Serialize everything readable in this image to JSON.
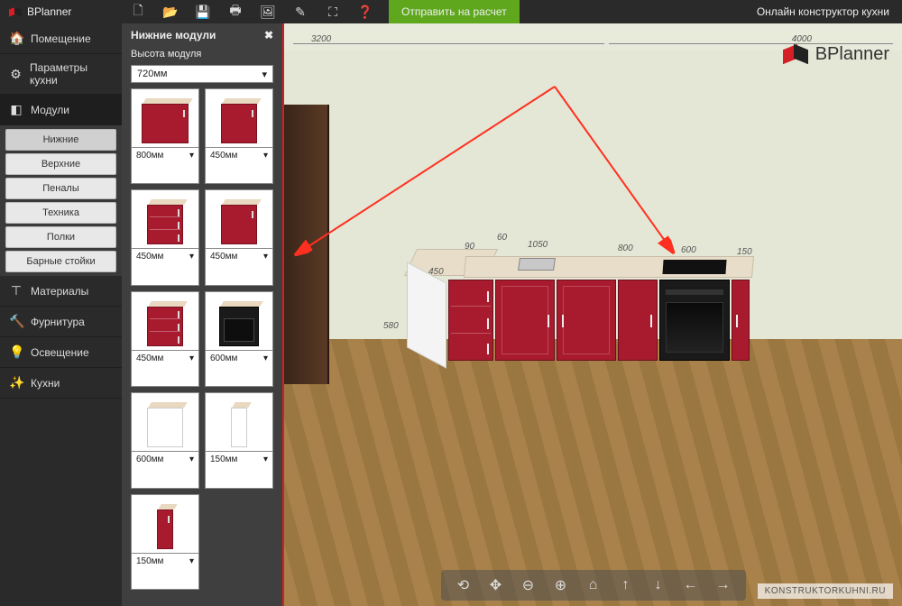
{
  "app": {
    "name": "BPlanner",
    "title": "Онлайн конструктор кухни"
  },
  "topbar": {
    "send_label": "Отправить на расчет",
    "icons": [
      "new-file",
      "open-file",
      "save",
      "print",
      "image",
      "edit",
      "fullscreen",
      "help"
    ]
  },
  "sidebar": {
    "room": "Помещение",
    "params": "Параметры кухни",
    "modules": "Модули",
    "materials": "Материалы",
    "hardware": "Фурнитура",
    "lighting": "Освещение",
    "kitchens": "Кухни",
    "sub": {
      "lower": "Нижние",
      "upper": "Верхние",
      "tall": "Пеналы",
      "appliances": "Техника",
      "shelves": "Полки",
      "bar": "Барные стойки"
    }
  },
  "palette": {
    "title": "Нижние модули",
    "height_label": "Высота модуля",
    "height_value": "720мм",
    "cards": [
      {
        "w": "800мм",
        "kind": "red"
      },
      {
        "w": "450мм",
        "kind": "red"
      },
      {
        "w": "450мм",
        "kind": "red-drawers"
      },
      {
        "w": "450мм",
        "kind": "red"
      },
      {
        "w": "450мм",
        "kind": "red-drawers"
      },
      {
        "w": "600мм",
        "kind": "oven"
      },
      {
        "w": "600мм",
        "kind": "white"
      },
      {
        "w": "150мм",
        "kind": "white-narrow"
      },
      {
        "w": "150мм",
        "kind": "red-narrow"
      }
    ]
  },
  "scene": {
    "dims": {
      "wall1": "3200",
      "wall2": "4000",
      "seg1": "1050",
      "seg2": "800",
      "seg3": "600",
      "seg4": "150",
      "d60": "60",
      "d90": "90",
      "d450": "450",
      "side": "580"
    }
  },
  "watermark": "KONSTRUKTORKUHNI.RU"
}
